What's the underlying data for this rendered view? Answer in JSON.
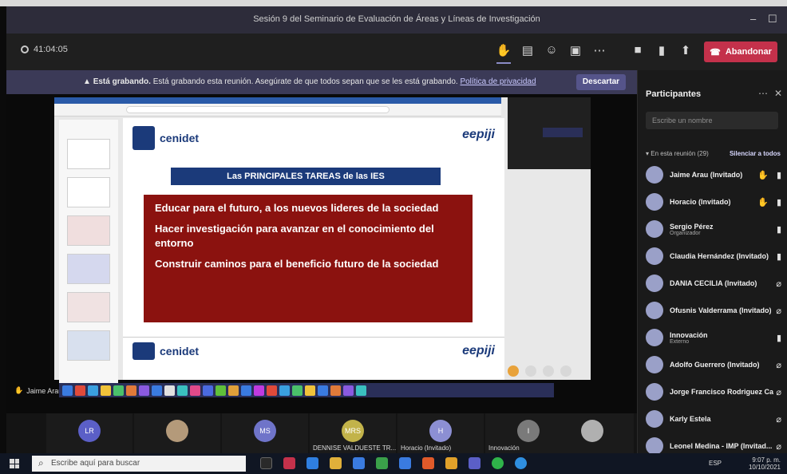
{
  "window": {
    "title": "Sesión 9 del Seminario de Evaluación de Áreas y Líneas de Investigación",
    "controls": [
      "–",
      "☐"
    ]
  },
  "toolbar": {
    "timer": "41:04:05",
    "leave_label": "Abandonar",
    "icons": [
      "hand-raise-icon",
      "chat-icon",
      "reactions-icon",
      "rooms-icon",
      "more-icon",
      "camera-icon",
      "mic-icon",
      "share-icon"
    ]
  },
  "banner": {
    "bold": "Está grabando.",
    "text": "Está grabando esta reunión. Asegúrate de que todos sepan que se les está grabando.",
    "link": "Política de privacidad",
    "dismiss": "Descartar"
  },
  "slide": {
    "logo_left": "cenidet",
    "logo_right": "eepiji",
    "headline": "Las PRINCIPALES TAREAS de las IES",
    "points": [
      "Educar para el futuro, a los nuevos lideres de la sociedad",
      "Hacer investigación para avanzar en el conocimiento del entorno",
      "Construir caminos para el beneficio futuro de la sociedad"
    ],
    "logo_left_2": "cenidet",
    "logo_right_2": "eepiji"
  },
  "presenter": {
    "name": "Jaime Arau (Invitado)"
  },
  "gallery": [
    {
      "initials": "LR",
      "color": "#5b5fc7",
      "label": ""
    },
    {
      "initials": "",
      "color": "#b49a7a",
      "label": ""
    },
    {
      "initials": "MS",
      "color": "#6f74c9",
      "label": ""
    },
    {
      "initials": "MRS",
      "color": "#c2b34a",
      "label": "DENNISE VALDUESTE TR..."
    },
    {
      "initials": "H",
      "color": "#8c8fd3",
      "label": "Horacio (Invitado)"
    },
    {
      "initials": "I",
      "color": "#7a7a7a",
      "label": "Innovación"
    },
    {
      "initials": "JA",
      "color": "#7e82d8",
      "label": "Jaime Arau (Invitado)"
    },
    {
      "initials": "",
      "color": "#b0b0b0",
      "label": ""
    }
  ],
  "participants": {
    "title": "Participantes",
    "search_placeholder": "Escribe un nombre",
    "section": "En esta reunión (29)",
    "mute_all": "Silenciar a todos",
    "people": [
      {
        "name": "Jaime Arau (Invitado)",
        "sub": "",
        "hand": true,
        "mic": "on"
      },
      {
        "name": "Horacio (Invitado)",
        "sub": "",
        "hand": true,
        "mic": "on"
      },
      {
        "name": "Sergio Pérez",
        "sub": "Organizador",
        "hand": false,
        "mic": "on"
      },
      {
        "name": "Claudia Hernández (Invitado)",
        "sub": "",
        "hand": false,
        "mic": "on"
      },
      {
        "name": "DANIA CECILIA (Invitado)",
        "sub": "",
        "hand": false,
        "mic": "off"
      },
      {
        "name": "Ofusnis Valderrama (Invitado)",
        "sub": "",
        "hand": false,
        "mic": "off"
      },
      {
        "name": "Innovación",
        "sub": "Externo",
        "hand": false,
        "mic": "on"
      },
      {
        "name": "Adolfo Guerrero (Invitado)",
        "sub": "",
        "hand": false,
        "mic": "off"
      },
      {
        "name": "Jorge Francisco Rodriguez Ca...",
        "sub": "",
        "hand": false,
        "mic": "off"
      },
      {
        "name": "Karly Estela",
        "sub": "",
        "hand": false,
        "mic": "off"
      },
      {
        "name": "Leonel Medina - IMP (Invitad...",
        "sub": "",
        "hand": false,
        "mic": "off"
      }
    ]
  },
  "taskbar": {
    "search_placeholder": "Escribe aquí para buscar",
    "time": "9:07 p. m.",
    "date": "10/10/2021",
    "lang": "ESP"
  }
}
